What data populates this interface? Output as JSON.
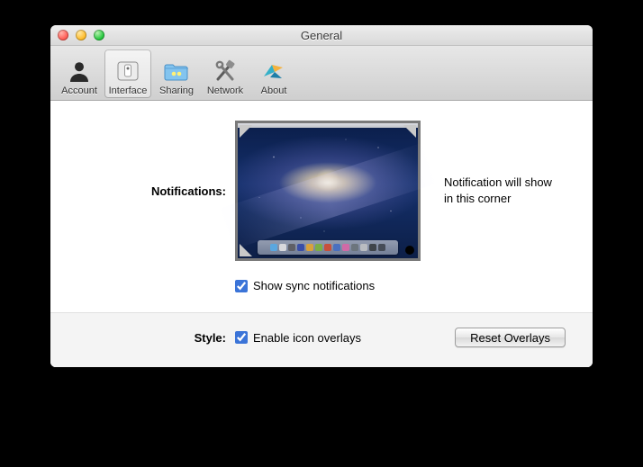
{
  "window": {
    "title": "General"
  },
  "toolbar": {
    "items": [
      {
        "label": "Account"
      },
      {
        "label": "Interface"
      },
      {
        "label": "Sharing"
      },
      {
        "label": "Network"
      },
      {
        "label": "About"
      }
    ],
    "selected_index": 1
  },
  "notifications": {
    "label": "Notifications:",
    "hint": "Notification will show\nin this corner",
    "show_sync_label": "Show sync notifications",
    "show_sync_checked": true,
    "selected_corner": "bottom-right"
  },
  "style": {
    "label": "Style:",
    "enable_overlays_label": "Enable icon overlays",
    "enable_overlays_checked": true,
    "reset_button": "Reset Overlays"
  },
  "dock_colors": [
    "#5aa7e0",
    "#d8d8dc",
    "#5f5f66",
    "#3a4ea8",
    "#d9a23c",
    "#7cae45",
    "#c8503c",
    "#4a70c0",
    "#d06aa6",
    "#6c757d",
    "#b9bcc1",
    "#3f444a",
    "#464c57"
  ]
}
